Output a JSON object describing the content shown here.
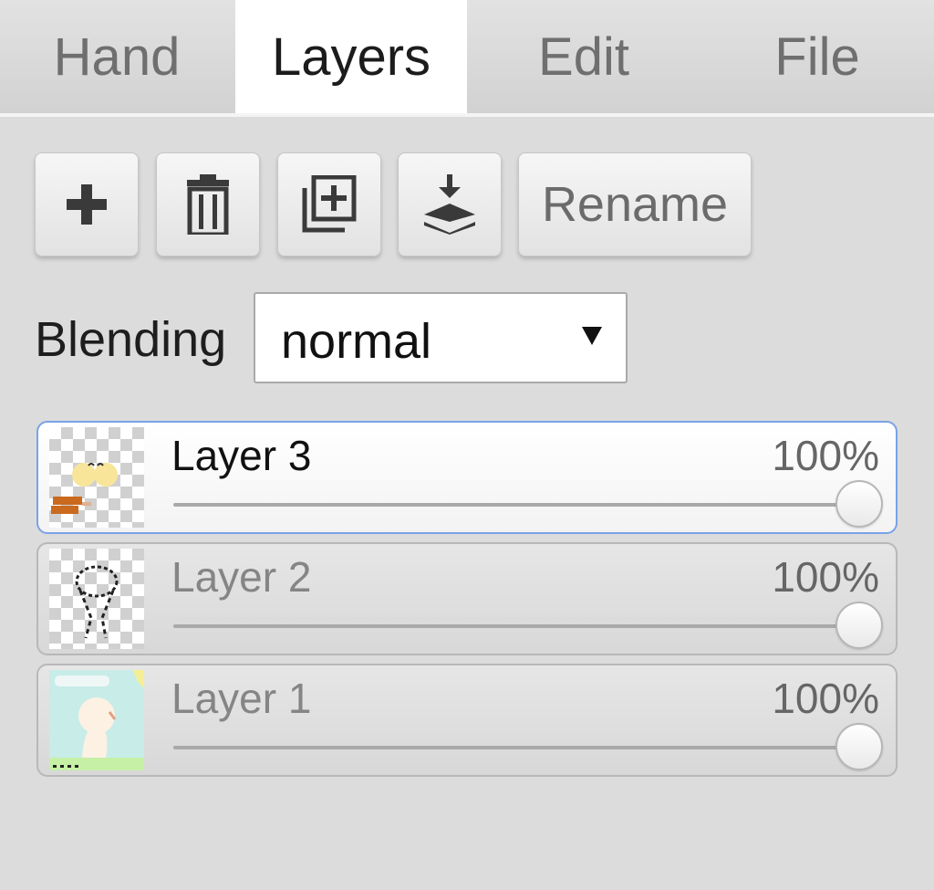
{
  "tabs": {
    "hand": "Hand",
    "layers": "Layers",
    "edit": "Edit",
    "file": "File",
    "active": "layers"
  },
  "toolbar": {
    "add_icon": "plus-icon",
    "delete_icon": "trash-icon",
    "duplicate_icon": "duplicate-icon",
    "merge_icon": "merge-down-icon",
    "rename_label": "Rename"
  },
  "blending": {
    "label": "Blending",
    "value": "normal"
  },
  "layers": [
    {
      "name": "Layer 3",
      "opacity_text": "100%",
      "opacity": 1.0,
      "selected": true
    },
    {
      "name": "Layer 2",
      "opacity_text": "100%",
      "opacity": 1.0,
      "selected": false
    },
    {
      "name": "Layer 1",
      "opacity_text": "100%",
      "opacity": 1.0,
      "selected": false
    }
  ],
  "colors": {
    "selection_border": "#7aa2e6",
    "panel_background": "#dcdcdc"
  }
}
